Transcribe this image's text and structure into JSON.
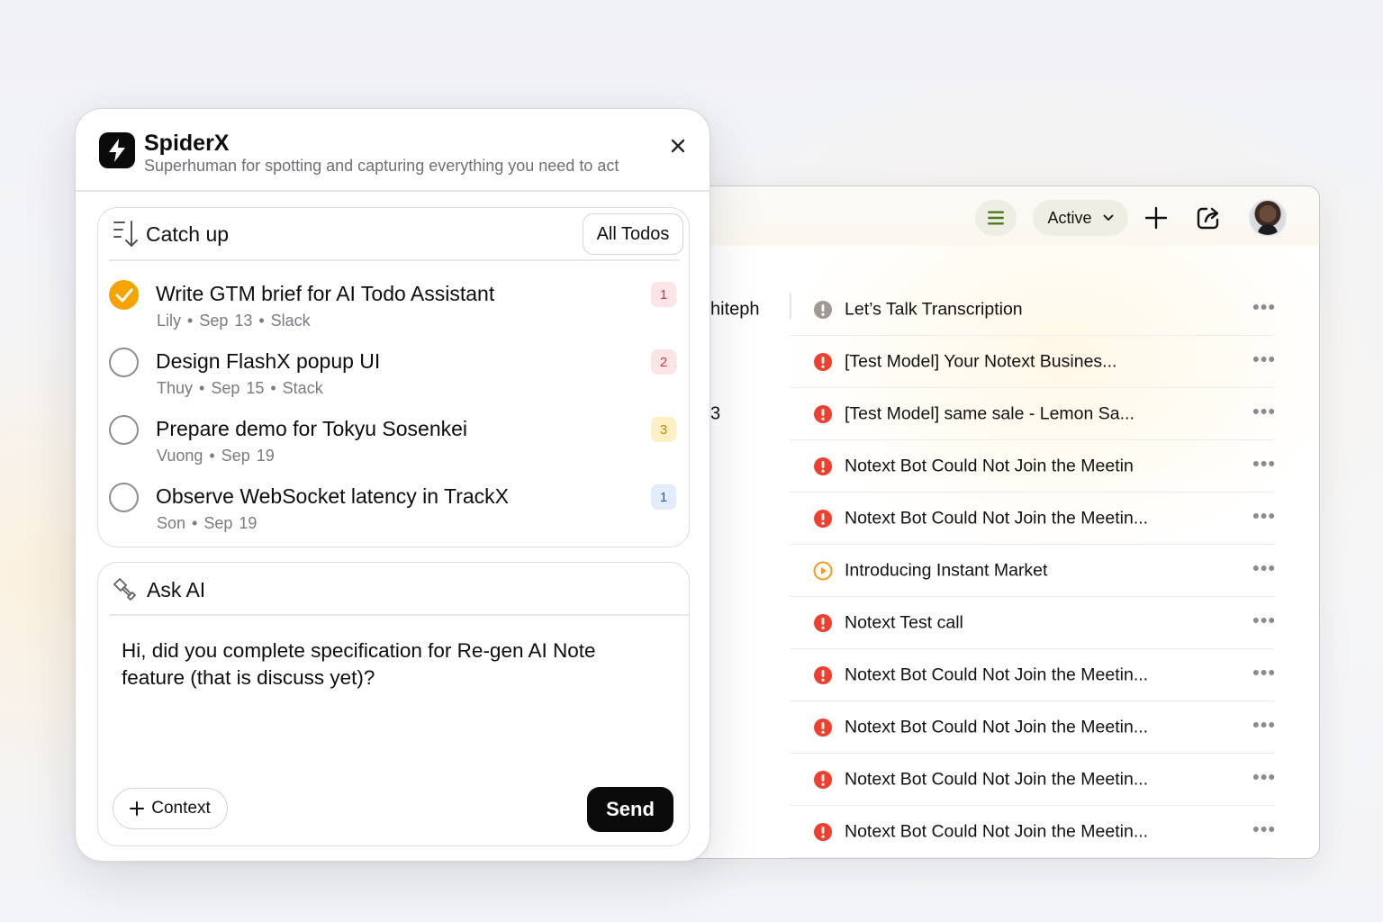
{
  "colors": {
    "accent_orange": "#f5a300",
    "alert_red": "#ef3f2f",
    "play_orange": "#f59a1b",
    "muted_gray": "#a09a94",
    "send_bg": "#0b0b0c"
  },
  "popup": {
    "app_name": "SpiderX",
    "tagline": "Superhuman for spotting and capturing everything you need to act",
    "catch_up": {
      "title": "Catch up",
      "all_todos_label": "All Todos",
      "todos": [
        {
          "title": "Write GTM brief for AI Todo Assistant",
          "meta": "Lily • Sep 13 • Slack",
          "priority": "1",
          "done": true
        },
        {
          "title": "Design FlashX popup UI",
          "meta": "Thuy • Sep 15 • Stack",
          "priority": "2",
          "done": false
        },
        {
          "title": "Prepare demo for Tokyu Sosenkei",
          "meta": "Vuong • Sep 19",
          "priority": "3",
          "done": false
        },
        {
          "title": "Observe WebSocket latency in TrackX",
          "meta": "Son • Sep 19",
          "priority": "1",
          "done": false
        }
      ]
    },
    "ask_ai": {
      "title": "Ask AI",
      "prompt": "Hi, did you complete specification for Re-gen AI Note feature (that is discuss yet)?",
      "context_label": "Context",
      "send_label": "Send"
    }
  },
  "background_app": {
    "toolbar": {
      "filter_label": "Active"
    },
    "rows": [
      {
        "left": "hiteph",
        "status": "muted",
        "title": "Let’s Talk Transcription"
      },
      {
        "left": "",
        "status": "alert",
        "title": "[Test Model] Your Notext Busines..."
      },
      {
        "left": "3",
        "status": "alert",
        "title": "[Test Model] same sale - Lemon Sa..."
      },
      {
        "left": "",
        "status": "alert",
        "title": "Notext Bot Could Not Join the Meetin"
      },
      {
        "left": "",
        "status": "alert",
        "title": "Notext Bot Could Not Join the Meetin..."
      },
      {
        "left": "",
        "status": "play",
        "title": "Introducing Instant Market"
      },
      {
        "left": "",
        "status": "alert",
        "title": "Notext Test call"
      },
      {
        "left": "",
        "status": "alert",
        "title": "Notext Bot Could Not Join the Meetin..."
      },
      {
        "left": "",
        "status": "alert",
        "title": "Notext Bot Could Not Join the Meetin..."
      },
      {
        "left": "",
        "status": "alert",
        "title": "Notext Bot Could Not Join the Meetin..."
      },
      {
        "left": "",
        "status": "alert",
        "title": "Notext Bot Could Not Join the Meetin..."
      }
    ],
    "row_more_glyph": "•••"
  }
}
